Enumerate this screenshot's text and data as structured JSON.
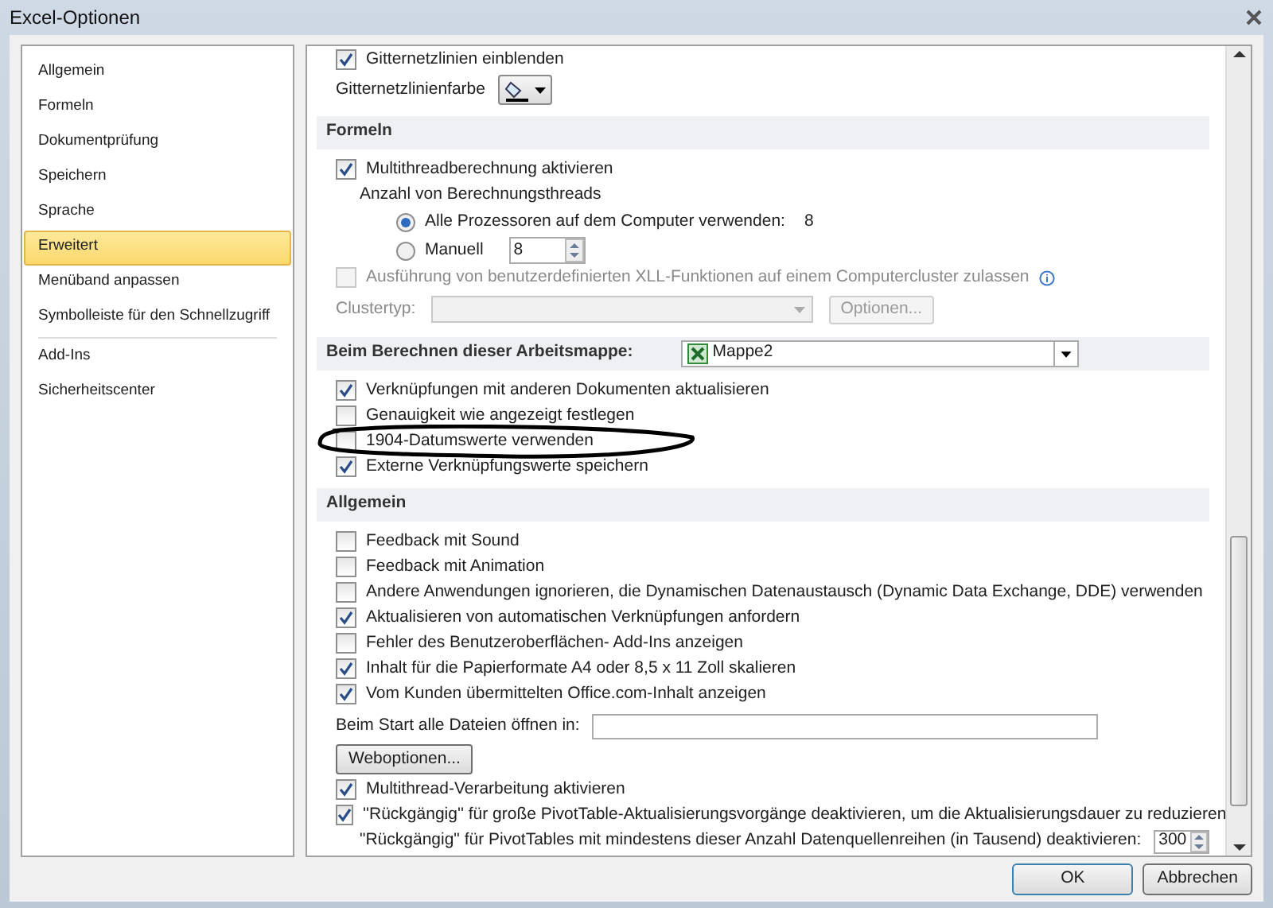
{
  "window": {
    "title": "Excel-Optionen"
  },
  "sidebar": {
    "items": [
      {
        "label": "Allgemein",
        "selected": false
      },
      {
        "label": "Formeln",
        "selected": false
      },
      {
        "label": "Dokumentprüfung",
        "selected": false
      },
      {
        "label": "Speichern",
        "selected": false
      },
      {
        "label": "Sprache",
        "selected": false
      },
      {
        "label": "Erweitert",
        "selected": true
      },
      {
        "label": "Menüband anpassen",
        "selected": false
      },
      {
        "label": "Symbolleiste für den Schnellzugriff",
        "selected": false,
        "divider_after": true
      },
      {
        "label": "Add-Ins",
        "selected": false
      },
      {
        "label": "Sicherheitscenter",
        "selected": false
      }
    ]
  },
  "options": [
    {
      "kind": "checkbox",
      "label": "Gitternetzlinien einblenden",
      "checked": true,
      "disabled": false
    },
    {
      "kind": "color",
      "label": "Gitternetzlinienfarbe"
    },
    {
      "kind": "header",
      "title": "Formeln"
    },
    {
      "kind": "checkbox",
      "label": "Multithreadberechnung aktivieren",
      "checked": true,
      "disabled": false
    },
    {
      "kind": "text",
      "label": "Anzahl von Berechnungsthreads"
    },
    {
      "kind": "radio",
      "label": "Alle Prozessoren auf dem Computer verwenden:",
      "selected": true,
      "count": "8"
    },
    {
      "kind": "radio",
      "label": "Manuell",
      "selected": false,
      "value": "8"
    },
    {
      "kind": "checkbox",
      "label": "Ausführung von benutzerdefinierten XLL-Funktionen auf einem Computercluster zulassen",
      "checked": false,
      "disabled": true,
      "info": true
    },
    {
      "kind": "combo",
      "label": "Clustertyp:",
      "button": "Optionen...",
      "disabled": true
    },
    {
      "kind": "header",
      "title": "Beim Berechnen dieser Arbeitsmappe:",
      "select": "Mappe2"
    },
    {
      "kind": "checkbox",
      "label": "Verknüpfungen mit anderen Dokumenten aktualisieren",
      "checked": true,
      "disabled": false
    },
    {
      "kind": "checkbox",
      "label": "Genauigkeit wie angezeigt festlegen",
      "checked": false,
      "disabled": false
    },
    {
      "kind": "checkbox",
      "label": "1904-Datumswerte verwenden",
      "checked": false,
      "disabled": false,
      "circled": true
    },
    {
      "kind": "checkbox",
      "label": "Externe Verknüpfungswerte speichern",
      "checked": true,
      "disabled": false
    },
    {
      "kind": "header",
      "title": "Allgemein"
    },
    {
      "kind": "checkbox",
      "label": "Feedback mit Sound",
      "checked": false,
      "disabled": false
    },
    {
      "kind": "checkbox",
      "label": "Feedback mit Animation",
      "checked": false,
      "disabled": false
    },
    {
      "kind": "checkbox",
      "label": "Andere Anwendungen ignorieren, die Dynamischen Datenaustausch (Dynamic Data Exchange, DDE) verwenden",
      "checked": false,
      "disabled": false
    },
    {
      "kind": "checkbox",
      "label": "Aktualisieren von automatischen Verknüpfungen anfordern",
      "checked": true,
      "disabled": false
    },
    {
      "kind": "checkbox",
      "label": "Fehler des Benutzeroberflächen- Add-Ins anzeigen",
      "checked": false,
      "disabled": false
    },
    {
      "kind": "checkbox",
      "label": "Inhalt für die Papierformate A4 oder 8,5 x 11 Zoll skalieren",
      "checked": true,
      "disabled": false
    },
    {
      "kind": "checkbox",
      "label": "Vom Kunden übermittelten Office.com-Inhalt anzeigen",
      "checked": true,
      "disabled": false
    },
    {
      "kind": "field",
      "label": "Beim Start alle Dateien öffnen in:"
    },
    {
      "kind": "button",
      "label": "Weboptionen..."
    },
    {
      "kind": "checkbox",
      "label": "Multithread-Verarbeitung aktivieren",
      "checked": true,
      "disabled": false
    },
    {
      "kind": "checkbox",
      "label": "''Rückgängig'' für große PivotTable-Aktualisierungsvorgänge deaktivieren, um die Aktualisierungsdauer zu reduzieren",
      "checked": true,
      "disabled": false
    },
    {
      "kind": "spin",
      "label": "\"Rückgängig\" für PivotTables mit mindestens dieser Anzahl Datenquellenreihen (in Tausend) deaktivieren:",
      "value": "300"
    }
  ],
  "buttons": [
    "OK",
    "Abbrechen"
  ]
}
